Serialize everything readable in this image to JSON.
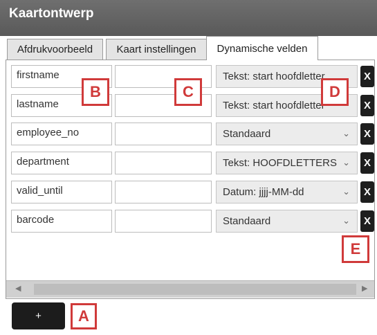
{
  "window": {
    "title": "Kaartontwerp"
  },
  "tabs": [
    {
      "label": "Afdrukvoorbeeld"
    },
    {
      "label": "Kaart instellingen"
    },
    {
      "label": "Dynamische velden"
    }
  ],
  "rows": [
    {
      "name": "firstname",
      "value": "",
      "format": "Tekst: start hoofdletter",
      "remove_label": "X"
    },
    {
      "name": "lastname",
      "value": "",
      "format": "Tekst: start hoofdletter",
      "remove_label": "X"
    },
    {
      "name": "employee_no",
      "value": "",
      "format": "Standaard",
      "remove_label": "X"
    },
    {
      "name": "department",
      "value": "",
      "format": "Tekst: HOOFDLETTERS",
      "remove_label": "X"
    },
    {
      "name": "valid_until",
      "value": "",
      "format": "Datum: jjjj-MM-dd",
      "remove_label": "X"
    },
    {
      "name": "barcode",
      "value": "",
      "format": "Standaard",
      "remove_label": "X"
    }
  ],
  "add_button": {
    "label": "+"
  },
  "callouts": {
    "a": "A",
    "b": "B",
    "c": "C",
    "d": "D",
    "e": "E"
  },
  "colors": {
    "callout": "#d03a3a",
    "titlebar": "#5f5f5f",
    "button": "#1c1c1c"
  }
}
